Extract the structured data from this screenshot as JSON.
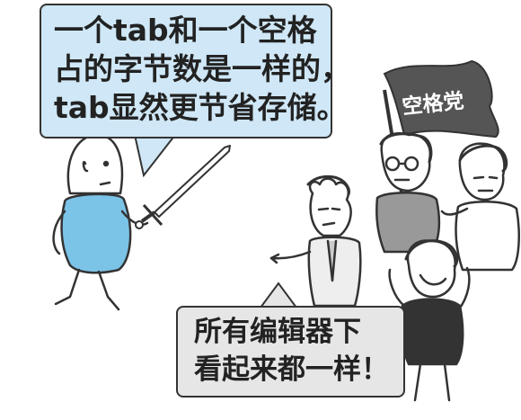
{
  "speech_left": {
    "lines": [
      "一个tab和一个空格",
      "占的字节数是一样的，",
      "tab显然更节省存储。"
    ]
  },
  "speech_right": {
    "lines": [
      "所有编辑器下",
      "看起来都一样！"
    ]
  },
  "flag": {
    "text": "空格党"
  },
  "colors": {
    "bubble_left": "#cfe7f6",
    "bubble_right": "#e6e6e6",
    "flag": "#555555",
    "shirt_blue": "#7cc3e8",
    "shirt_gray": "#8a8a8a",
    "shirt_dark": "#333333"
  }
}
